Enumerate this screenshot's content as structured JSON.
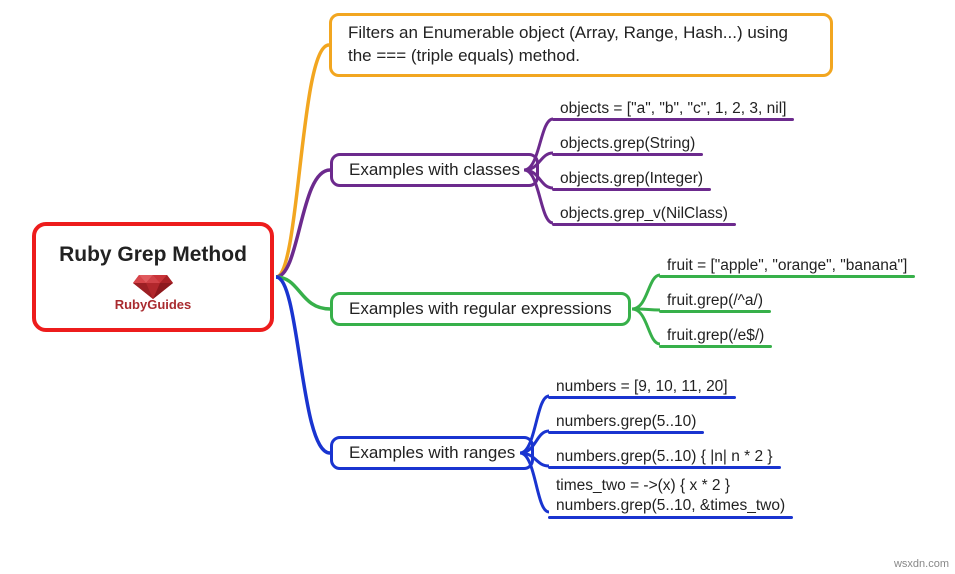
{
  "root": {
    "title": "Ruby Grep Method",
    "brand_prefix": "Ruby",
    "brand_suffix": "Guides"
  },
  "branches": {
    "description": "Filters an Enumerable object (Array, Range, Hash...) using the === (triple equals) method.",
    "classes": {
      "label": "Examples with classes",
      "items": [
        "objects = [\"a\", \"b\", \"c\", 1, 2, 3, nil]",
        "objects.grep(String)",
        "objects.grep(Integer)",
        "objects.grep_v(NilClass)"
      ]
    },
    "regex": {
      "label": "Examples with regular expressions",
      "items": [
        "fruit = [\"apple\", \"orange\", \"banana\"]",
        "fruit.grep(/^a/)",
        "fruit.grep(/e$/)"
      ]
    },
    "ranges": {
      "label": "Examples with ranges",
      "items": [
        "numbers = [9, 10, 11, 20]",
        "numbers.grep(5..10)",
        "numbers.grep(5..10) { |n| n * 2 }",
        "times_two = ->(x) { x * 2 }\nnumbers.grep(5..10, &times_two)"
      ]
    }
  },
  "watermark": "wsxdn.com",
  "colors": {
    "root": "#ed1c1c",
    "orange": "#f2a620",
    "purple": "#6c2a8d",
    "green": "#37b04a",
    "blue": "#1934d0"
  }
}
